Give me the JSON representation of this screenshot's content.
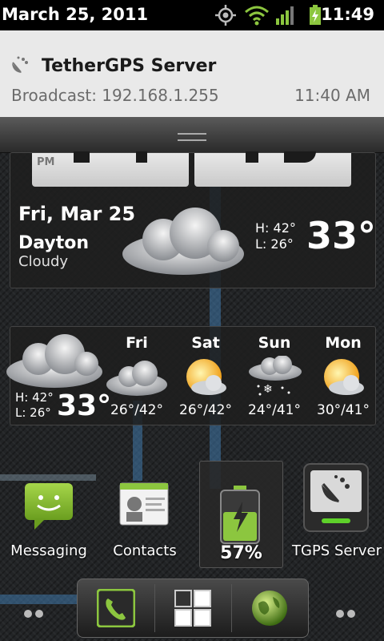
{
  "status_bar": {
    "date": "March 25, 2011",
    "time": "11:49",
    "icons": [
      "gps-icon",
      "wifi-icon",
      "signal-icon",
      "battery-charging-icon"
    ]
  },
  "notification": {
    "icon": "satellite-icon",
    "title": "TetherGPS Server",
    "text": "Broadcast: 192.168.1.255",
    "time": "11:40 AM"
  },
  "clock_widget": {
    "meridiem": "PM"
  },
  "weather": {
    "date": "Fri, Mar 25",
    "city": "Dayton",
    "condition": "Cloudy",
    "high": "H:  42°",
    "low": "L:  26°",
    "temp": "33°",
    "icon": "cloudy-icon"
  },
  "forecast": {
    "current": {
      "high": "H: 42°",
      "low": "L: 26°",
      "temp": "33°",
      "icon": "cloudy-icon"
    },
    "days": [
      {
        "name": "Fri",
        "range": "26°/42°",
        "icon": "cloudy-icon"
      },
      {
        "name": "Sat",
        "range": "26°/42°",
        "icon": "partly-sunny-icon"
      },
      {
        "name": "Sun",
        "range": "24°/41°",
        "icon": "snow-icon"
      },
      {
        "name": "Mon",
        "range": "30°/41°",
        "icon": "partly-sunny-icon"
      }
    ]
  },
  "apps": [
    {
      "label": "Messaging",
      "icon": "messaging-icon"
    },
    {
      "label": "Contacts",
      "icon": "contacts-icon"
    },
    {
      "label": "57%",
      "icon": "battery-widget-icon",
      "level": 0.57
    },
    {
      "label": "TGPS Server",
      "icon": "tgps-server-icon"
    }
  ],
  "dock": {
    "items": [
      "phone-icon",
      "app-drawer-icon",
      "browser-icon"
    ]
  },
  "colors": {
    "accent_green": "#8cc63f",
    "notification_bg": "#e9e9e9"
  }
}
